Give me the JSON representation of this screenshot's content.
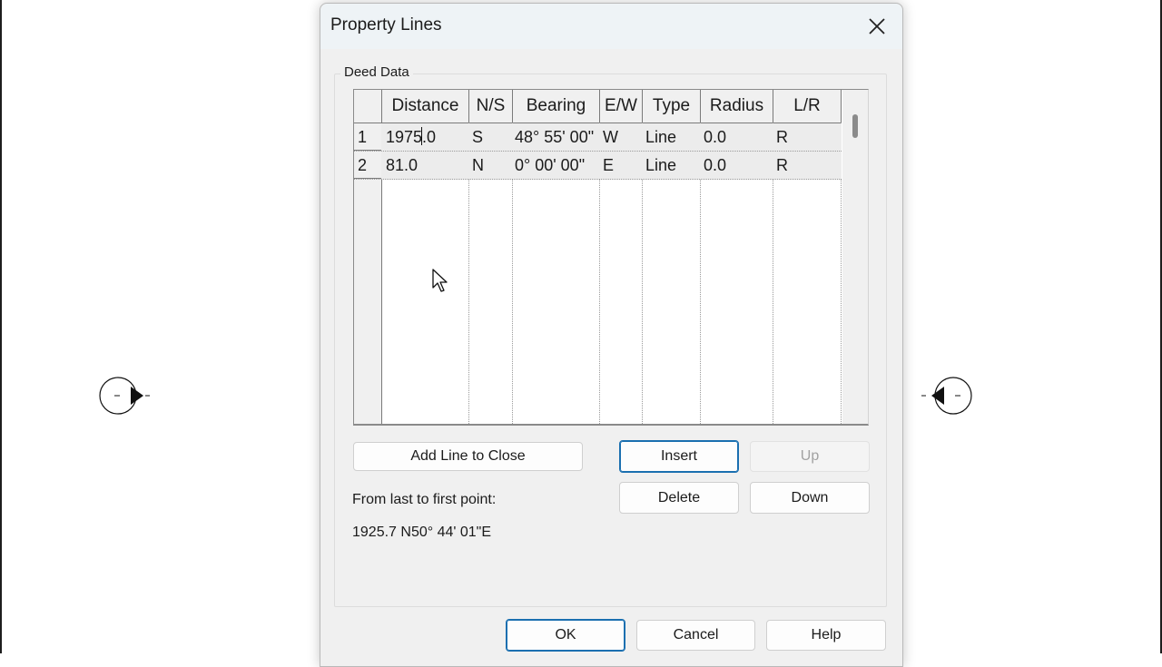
{
  "dialog": {
    "title": "Property Lines",
    "close_icon": "close-icon"
  },
  "deed_data": {
    "label": "Deed Data",
    "columns": [
      "Distance",
      "N/S",
      "Bearing",
      "E/W",
      "Type",
      "Radius",
      "L/R"
    ],
    "rows": [
      {
        "num": "1",
        "distance_before_caret": "1975",
        "distance_after_caret": ".0",
        "ns": "S",
        "bearing": "48° 55' 00\"",
        "ew": "W",
        "type": "Line",
        "radius": "0.0",
        "lr": "R"
      },
      {
        "num": "2",
        "distance": "81.0",
        "ns": "N",
        "bearing": "0° 00' 00\"",
        "ew": "E",
        "type": "Line",
        "radius": "0.0",
        "lr": "R"
      }
    ]
  },
  "buttons": {
    "add_line_to_close": "Add Line to Close",
    "insert": "Insert",
    "up": "Up",
    "delete": "Delete",
    "down": "Down",
    "ok": "OK",
    "cancel": "Cancel",
    "help": "Help"
  },
  "closure": {
    "label": "From last to first point:",
    "value": "1925.7 N50° 44' 01\"E"
  },
  "canvas": {
    "left_marker": "level-head-icon",
    "right_marker": "level-head-icon"
  }
}
